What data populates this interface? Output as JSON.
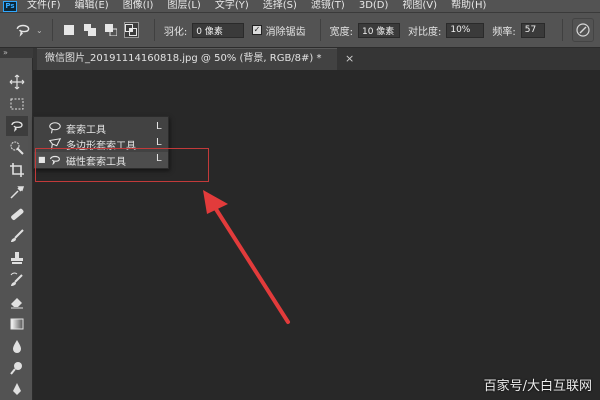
{
  "app": {
    "logo_text": "Ps"
  },
  "menubar": {
    "items": [
      "文件(F)",
      "编辑(E)",
      "图像(I)",
      "图层(L)",
      "文字(Y)",
      "选择(S)",
      "滤镜(T)",
      "3D(D)",
      "视图(V)",
      "帮助(H)"
    ]
  },
  "options": {
    "tool_icon": "magnetic-lasso-icon",
    "feather_label": "羽化:",
    "feather_value": "0 像素",
    "antialias_label": "消除锯齿",
    "antialias_checked": true,
    "width_label": "宽度:",
    "width_value": "10 像素",
    "contrast_label": "对比度:",
    "contrast_value": "10%",
    "frequency_label": "频率:",
    "frequency_value": "57"
  },
  "toolbar": {
    "head": "»"
  },
  "document": {
    "tab_title": "微信图片_20191114160818.jpg @ 50% (背景, RGB/8#) *",
    "close": "×"
  },
  "flyout": {
    "items": [
      {
        "label": "套索工具",
        "shortcut": "L",
        "icon": "lasso-icon",
        "selected": false
      },
      {
        "label": "多边形套索工具",
        "shortcut": "L",
        "icon": "polygonal-lasso-icon",
        "selected": false
      },
      {
        "label": "磁性套索工具",
        "shortcut": "L",
        "icon": "magnetic-lasso-icon",
        "selected": true,
        "bullet": "■"
      }
    ]
  },
  "annotation": {
    "highlight_color": "#c23a3a",
    "arrow_color": "#e23b3b"
  },
  "watermark": "百家号/大白互联网"
}
